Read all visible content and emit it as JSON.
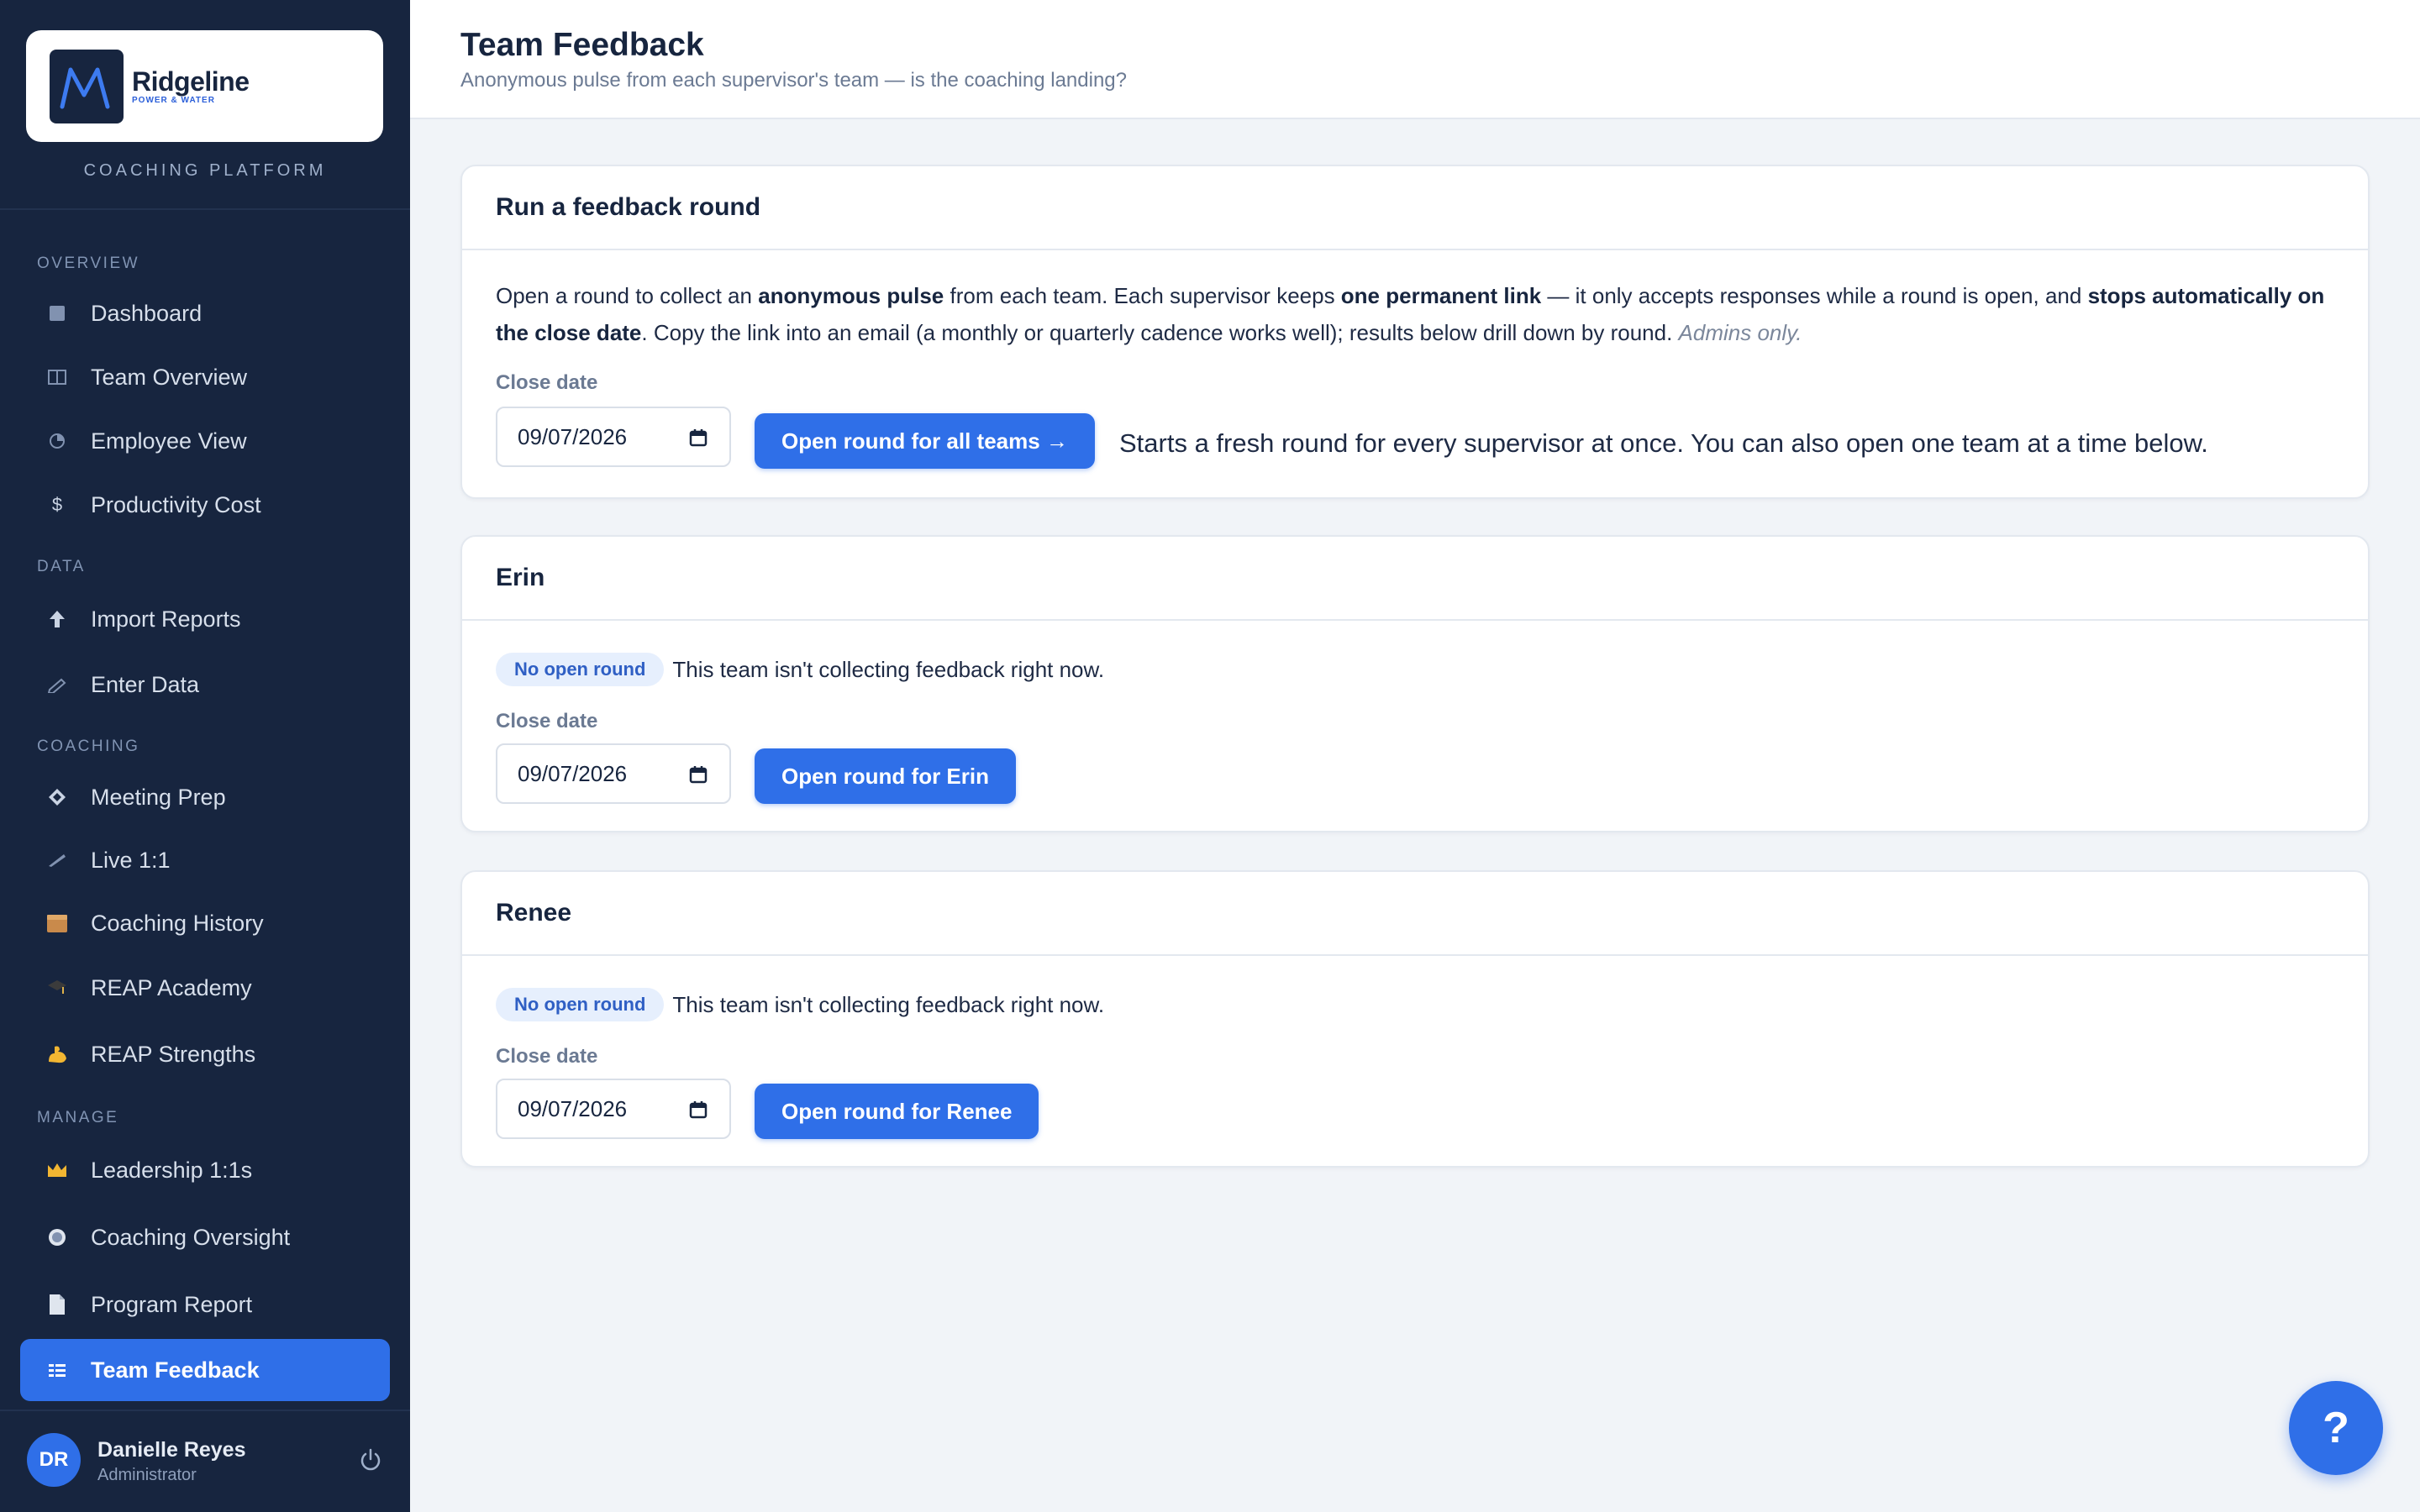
{
  "brand": {
    "name": "Ridgeline",
    "tagline": "POWER & WATER",
    "platform_label": "COACHING PLATFORM"
  },
  "sidebar": {
    "sections": [
      {
        "label": "OVERVIEW"
      },
      {
        "label": "DATA"
      },
      {
        "label": "COACHING"
      },
      {
        "label": "MANAGE"
      }
    ],
    "items": [
      {
        "label": "Dashboard",
        "icon": "square-icon"
      },
      {
        "label": "Team Overview",
        "icon": "columns-icon"
      },
      {
        "label": "Employee View",
        "icon": "pie-icon"
      },
      {
        "label": "Productivity Cost",
        "icon": "dollar-icon"
      },
      {
        "label": "Import Reports",
        "icon": "upload-arrow-icon"
      },
      {
        "label": "Enter Data",
        "icon": "pencil-icon"
      },
      {
        "label": "Meeting Prep",
        "icon": "diamond-icon"
      },
      {
        "label": "Live 1:1",
        "icon": "pen-icon"
      },
      {
        "label": "Coaching History",
        "icon": "box-icon"
      },
      {
        "label": "REAP Academy",
        "icon": "grad-cap-icon"
      },
      {
        "label": "REAP Strengths",
        "icon": "flexed-arm-icon"
      },
      {
        "label": "Leadership 1:1s",
        "icon": "crown-icon"
      },
      {
        "label": "Coaching Oversight",
        "icon": "radio-icon"
      },
      {
        "label": "Program Report",
        "icon": "document-icon"
      },
      {
        "label": "Team Feedback",
        "icon": "list-icon",
        "active": true
      }
    ]
  },
  "user": {
    "initials": "DR",
    "name": "Danielle Reyes",
    "role": "Administrator"
  },
  "header": {
    "title": "Team Feedback",
    "subtitle": "Anonymous pulse from each supervisor's team — is the coaching landing?"
  },
  "round_card": {
    "title": "Run a feedback round",
    "desc_parts": [
      "Open a round to collect an ",
      "anonymous pulse",
      " from each team. Each supervisor keeps ",
      "one permanent link",
      " — it only accepts responses while a round is open, and ",
      "stops automatically on the close date",
      ". Copy the link into an email (a monthly or quarterly cadence works well); results below drill down by round. ",
      "Admins only."
    ],
    "close_date_label": "Close date",
    "close_date_value": "09/07/2026",
    "button_label": "Open round for all teams →",
    "hint": "Starts a fresh round for every supervisor at once. You can also open one team at a time below."
  },
  "teams": [
    {
      "name": "Erin",
      "badge": "No open round",
      "status_text": "This team isn't collecting feedback right now.",
      "close_date_label": "Close date",
      "close_date_value": "09/07/2026",
      "button_label": "Open round for Erin"
    },
    {
      "name": "Renee",
      "badge": "No open round",
      "status_text": "This team isn't collecting feedback right now.",
      "close_date_label": "Close date",
      "close_date_value": "09/07/2026",
      "button_label": "Open round for Renee"
    }
  ],
  "help_button": {
    "label": "?"
  },
  "colors": {
    "sidebar_bg": "#17253f",
    "accent": "#2f6fe8",
    "page_bg": "#f1f4f8",
    "badge_bg": "#e6effd"
  }
}
